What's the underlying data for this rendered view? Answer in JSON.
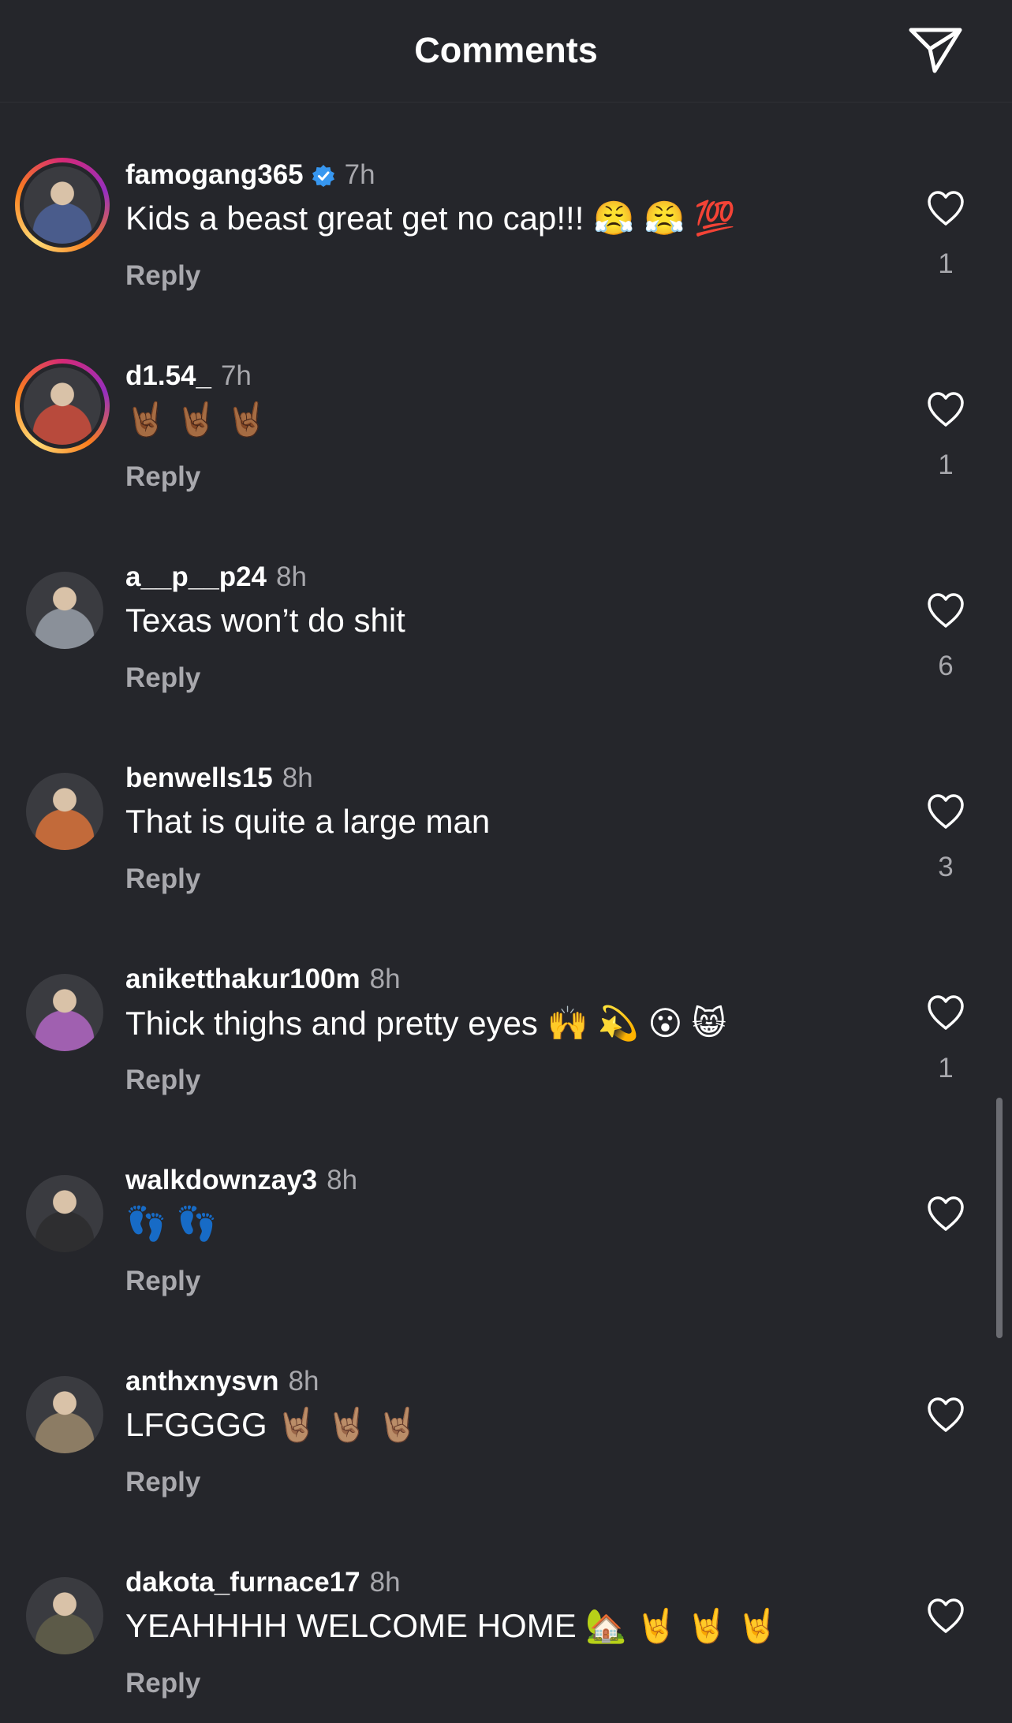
{
  "header": {
    "title": "Comments"
  },
  "comments": [
    {
      "username": "famogang365",
      "verified": true,
      "time": "7h",
      "text": "Kids a beast great get no cap!!! 😤 😤 💯",
      "reply": "Reply",
      "likes": "1",
      "ring": true,
      "avatar_color": "#4a5c8c"
    },
    {
      "username": "d1.54_",
      "verified": false,
      "time": "7h",
      "text": "🤘🏾 🤘🏾 🤘🏾",
      "reply": "Reply",
      "likes": "1",
      "ring": true,
      "avatar_color": "#b84a3c"
    },
    {
      "username": "a__p__p24",
      "verified": false,
      "time": "8h",
      "text": "Texas won’t do shit",
      "reply": "Reply",
      "likes": "6",
      "ring": false,
      "avatar_color": "#8a9099"
    },
    {
      "username": "benwells15",
      "verified": false,
      "time": "8h",
      "text": "That is quite a large man",
      "reply": "Reply",
      "likes": "3",
      "ring": false,
      "avatar_color": "#c26a3a"
    },
    {
      "username": "aniketthakur100m",
      "verified": false,
      "time": "8h",
      "text": "Thick thighs and pretty eyes 🙌 💫 😮 😸",
      "reply": "Reply",
      "likes": "1",
      "ring": false,
      "avatar_color": "#a060b0"
    },
    {
      "username": "walkdownzay3",
      "verified": false,
      "time": "8h",
      "text": "👣 👣",
      "reply": "Reply",
      "likes": "",
      "ring": false,
      "avatar_color": "#2e2e30"
    },
    {
      "username": "anthxnysvn",
      "verified": false,
      "time": "8h",
      "text": "LFGGGG 🤘🏽 🤘🏽 🤘🏽",
      "reply": "Reply",
      "likes": "",
      "ring": false,
      "avatar_color": "#8c7c64"
    },
    {
      "username": "dakota_furnace17",
      "verified": false,
      "time": "8h",
      "text": "YEAHHHH WELCOME HOME 🏡 🤘 🤘 🤘",
      "reply": "Reply",
      "likes": "",
      "ring": false,
      "avatar_color": "#5c5a48"
    }
  ]
}
